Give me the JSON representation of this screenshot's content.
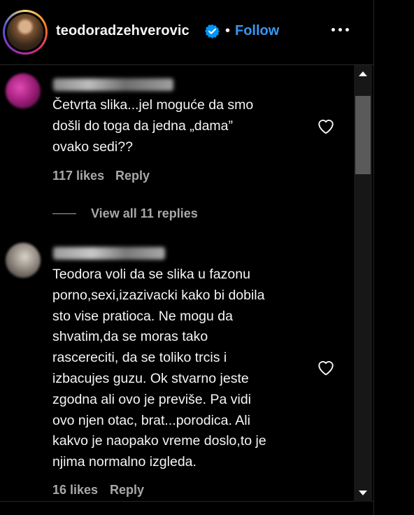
{
  "header": {
    "username": "teodoradzehverovic",
    "separator": "•",
    "follow_label": "Follow"
  },
  "comments": [
    {
      "text_lines": [
        "Četvrta slika...jel moguće da smo",
        "došli do toga da jedna „dama”",
        "ovako sedi??"
      ],
      "likes": "117 likes",
      "reply_label": "Reply",
      "view_replies": "View all 11 replies"
    },
    {
      "text_lines": [
        "Teodora voli da se slika u fazonu",
        "porno,sexi,izazivacki kako bi dobila",
        "sto vise pratioca. Ne mogu da",
        "shvatim,da se moras tako",
        "rascereciti, da se toliko trcis i",
        "izbacujes guzu. Ok stvarno jeste",
        "zgodna ali ovo je previše. Pa vidi",
        "ovo njen otac, brat...porodica. Ali",
        "kakvo je naopako vreme doslo,to je",
        "njima normalno izgleda."
      ],
      "likes": "16 likes",
      "reply_label": "Reply"
    }
  ],
  "colors": {
    "background": "#000000",
    "text": "#f5f5f5",
    "secondary": "#a8a8a8",
    "follow": "#3897f0",
    "verified": "#0095f6"
  }
}
